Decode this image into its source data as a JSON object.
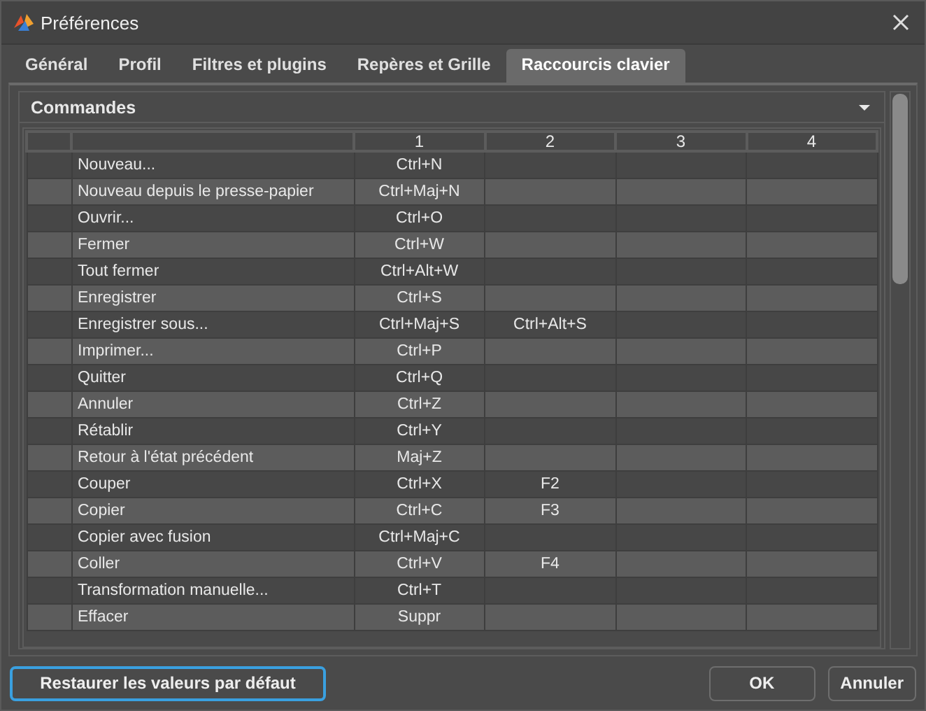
{
  "window": {
    "title": "Préférences"
  },
  "tabs": [
    {
      "label": "Général",
      "selected": false
    },
    {
      "label": "Profil",
      "selected": false
    },
    {
      "label": "Filtres et plugins",
      "selected": false
    },
    {
      "label": "Repères et Grille",
      "selected": false
    },
    {
      "label": "Raccourcis clavier",
      "selected": true
    }
  ],
  "section": {
    "title": "Commandes",
    "expanded": true
  },
  "table": {
    "columns": [
      "1",
      "2",
      "3",
      "4"
    ],
    "rows": [
      {
        "command": "Nouveau...",
        "shortcuts": [
          "Ctrl+N"
        ]
      },
      {
        "command": "Nouveau depuis le presse-papier",
        "shortcuts": [
          "Ctrl+Maj+N"
        ]
      },
      {
        "command": "Ouvrir...",
        "shortcuts": [
          "Ctrl+O"
        ]
      },
      {
        "command": "Fermer",
        "shortcuts": [
          "Ctrl+W"
        ]
      },
      {
        "command": "Tout fermer",
        "shortcuts": [
          "Ctrl+Alt+W"
        ]
      },
      {
        "command": "Enregistrer",
        "shortcuts": [
          "Ctrl+S"
        ]
      },
      {
        "command": "Enregistrer sous...",
        "shortcuts": [
          "Ctrl+Maj+S",
          "Ctrl+Alt+S"
        ]
      },
      {
        "command": "Imprimer...",
        "shortcuts": [
          "Ctrl+P"
        ]
      },
      {
        "command": "Quitter",
        "shortcuts": [
          "Ctrl+Q"
        ]
      },
      {
        "command": "Annuler",
        "shortcuts": [
          "Ctrl+Z"
        ]
      },
      {
        "command": "Rétablir",
        "shortcuts": [
          "Ctrl+Y"
        ]
      },
      {
        "command": "Retour à l'état précédent",
        "shortcuts": [
          "Maj+Z"
        ]
      },
      {
        "command": "Couper",
        "shortcuts": [
          "Ctrl+X",
          "F2"
        ]
      },
      {
        "command": "Copier",
        "shortcuts": [
          "Ctrl+C",
          "F3"
        ]
      },
      {
        "command": "Copier avec fusion",
        "shortcuts": [
          "Ctrl+Maj+C"
        ]
      },
      {
        "command": "Coller",
        "shortcuts": [
          "Ctrl+V",
          "F4"
        ]
      },
      {
        "command": "Transformation manuelle...",
        "shortcuts": [
          "Ctrl+T"
        ]
      },
      {
        "command": "Effacer",
        "shortcuts": [
          "Suppr"
        ]
      }
    ]
  },
  "buttons": [
    {
      "label": "Restaurer les valeurs par défaut",
      "focused": true
    },
    {
      "label": "OK",
      "focused": false
    },
    {
      "label": "Annuler",
      "focused": false
    }
  ]
}
